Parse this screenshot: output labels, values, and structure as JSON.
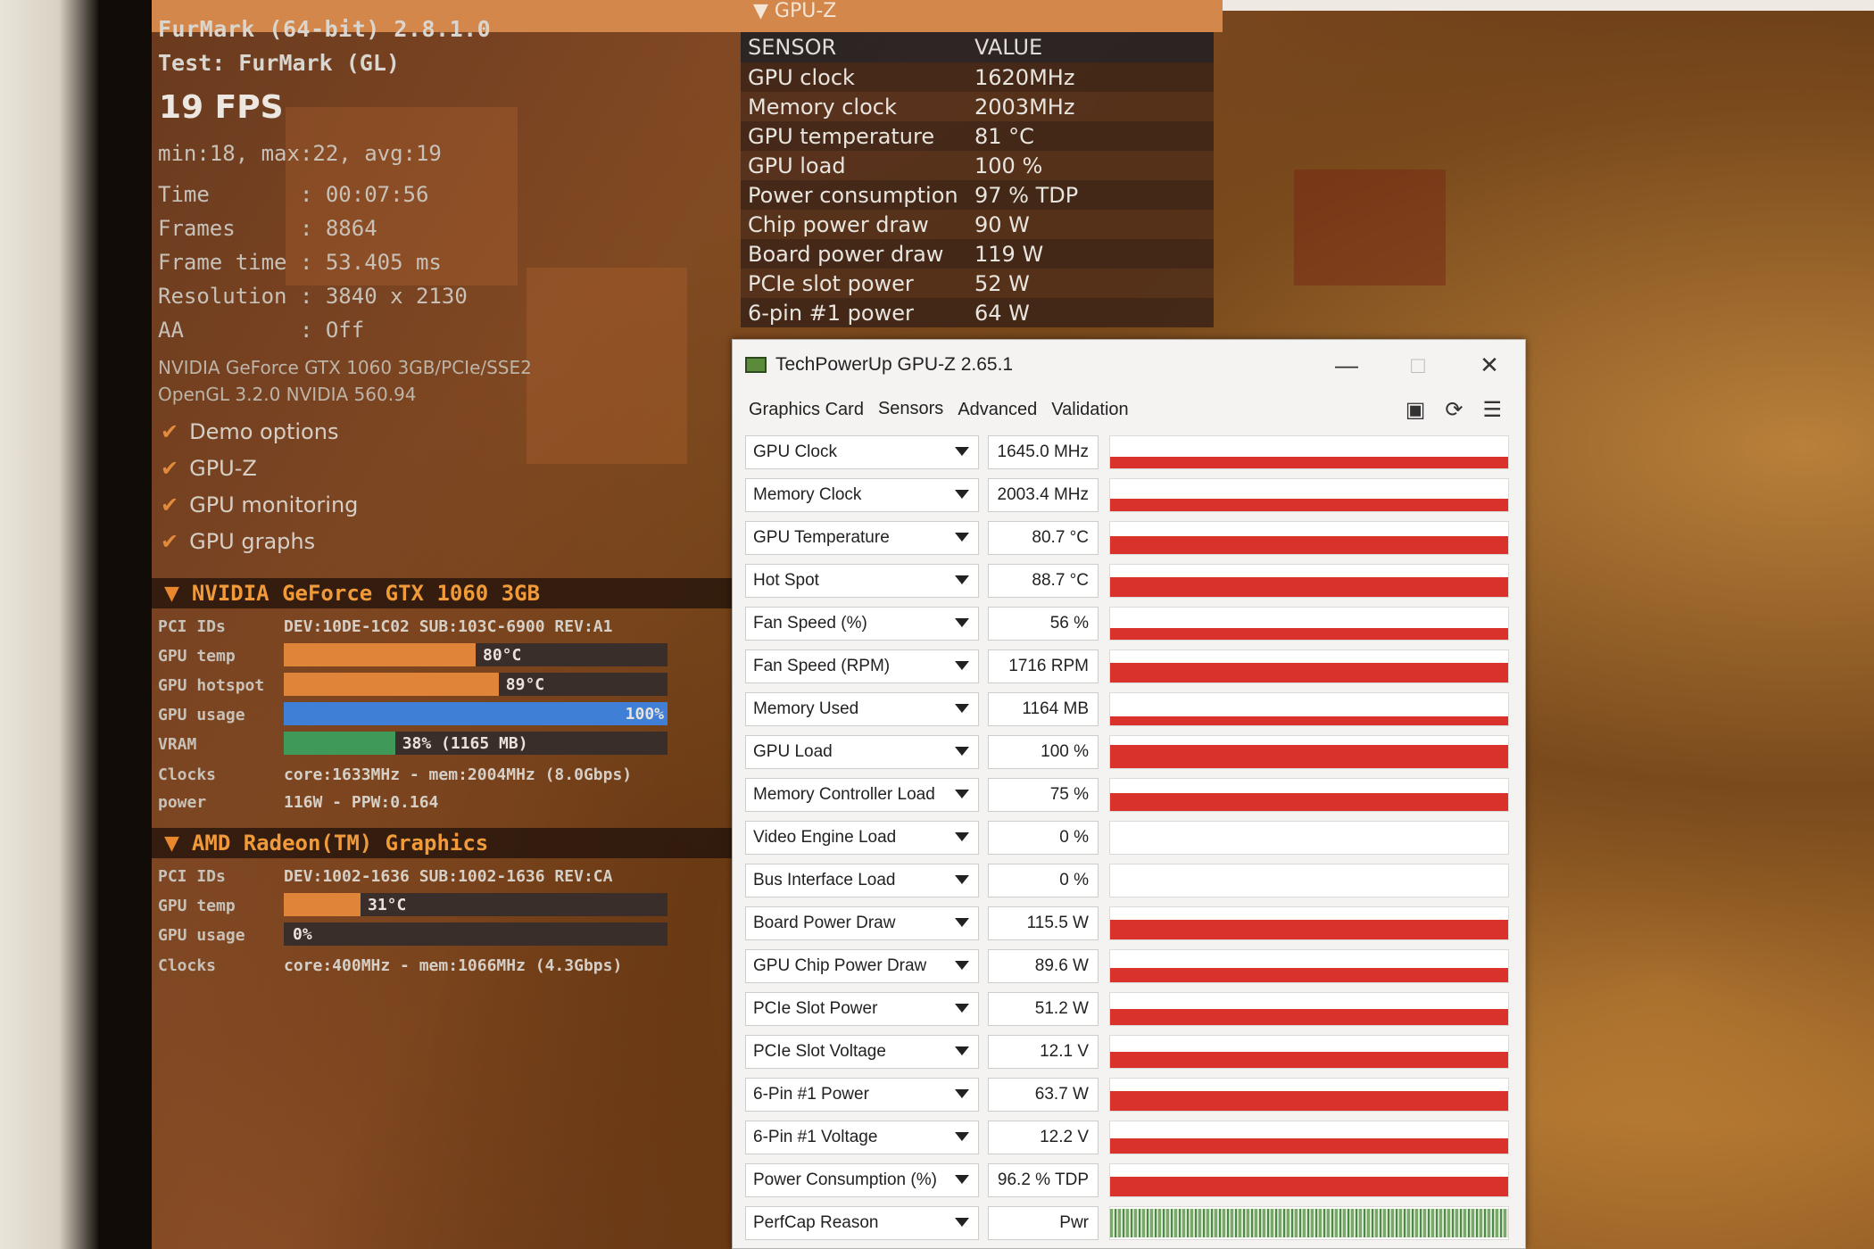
{
  "furmark": {
    "title": "FurMark (64-bit) 2.8.1.0",
    "test": "Test: FurMark (GL)",
    "fps": "19 FPS",
    "minmax": "min:18, max:22, avg:19",
    "stats": [
      {
        "label": "Time      ",
        "value": ": 00:07:56"
      },
      {
        "label": "Frames    ",
        "value": ": 8864"
      },
      {
        "label": "Frame time",
        "value": ": 53.405 ms"
      },
      {
        "label": "Resolution",
        "value": ": 3840 x 2130"
      },
      {
        "label": "AA        ",
        "value": ": Off"
      }
    ],
    "renderer": "NVIDIA GeForce GTX 1060 3GB/PCIe/SSE2",
    "opengl": "OpenGL 3.2.0 NVIDIA 560.94",
    "options": [
      "Demo options",
      "GPU-Z",
      "GPU monitoring",
      "GPU graphs"
    ],
    "gpu1": {
      "name": "NVIDIA GeForce GTX 1060 3GB",
      "pci_label": "PCI IDs",
      "pci": "DEV:10DE-1C02 SUB:103C-6900 REV:A1",
      "temp_label": "GPU temp",
      "temp": "80°C",
      "temp_pct": 0.5,
      "hotspot_label": "GPU hotspot",
      "hotspot": "89°C",
      "hotspot_pct": 0.56,
      "usage_label": "GPU usage",
      "usage": "100%",
      "usage_pct": 1.0,
      "vram_label": "VRAM",
      "vram": "38% (1165 MB)",
      "vram_pct": 0.29,
      "clocks_label": "Clocks",
      "clocks": "core:1633MHz - mem:2004MHz (8.0Gbps)",
      "power_label": "power",
      "power": "116W - PPW:0.164"
    },
    "gpu2": {
      "name": "AMD Radeon(TM) Graphics",
      "pci_label": "PCI IDs",
      "pci": "DEV:1002-1636 SUB:1002-1636 REV:CA",
      "temp_label": "GPU temp",
      "temp": "31°C",
      "temp_pct": 0.2,
      "usage_label": "GPU usage",
      "usage": "0%",
      "usage_pct": 0.0,
      "clocks_label": "Clocks",
      "clocks": "core:400MHz - mem:1066MHz (4.3Gbps)"
    },
    "colors": {
      "orange_bar": "#e0843a",
      "blue_bar": "#3f7fd6",
      "green_bar": "#3f9a5a"
    }
  },
  "gpuz_overlay": {
    "header": "▼ GPU-Z",
    "col_sensor": "SENSOR",
    "col_value": "VALUE",
    "rows": [
      {
        "sensor": "GPU clock",
        "value": "1620MHz"
      },
      {
        "sensor": "Memory clock",
        "value": "2003MHz"
      },
      {
        "sensor": "GPU temperature",
        "value": "81 °C"
      },
      {
        "sensor": "GPU load",
        "value": "100 %"
      },
      {
        "sensor": "Power consumption",
        "value": "97 % TDP"
      },
      {
        "sensor": "Chip power draw",
        "value": "90 W"
      },
      {
        "sensor": "Board power draw",
        "value": "119 W"
      },
      {
        "sensor": "PCIe slot power",
        "value": "52 W"
      },
      {
        "sensor": "6-pin #1 power",
        "value": "64 W"
      }
    ]
  },
  "gpuz_window": {
    "title": "TechPowerUp GPU-Z 2.65.1",
    "tabs": [
      "Graphics Card",
      "Sensors",
      "Advanced",
      "Validation"
    ],
    "active_tab": "Sensors",
    "icons": [
      "camera-icon",
      "refresh-icon",
      "menu-icon"
    ],
    "sensors": [
      {
        "name": "GPU Clock",
        "value": "1645.0 MHz",
        "level": 0.36
      },
      {
        "name": "Memory Clock",
        "value": "2003.4 MHz",
        "level": 0.4
      },
      {
        "name": "GPU Temperature",
        "value": "80.7 °C",
        "level": 0.55
      },
      {
        "name": "Hot Spot",
        "value": "88.7 °C",
        "level": 0.62
      },
      {
        "name": "Fan Speed (%)",
        "value": "56 %",
        "level": 0.36
      },
      {
        "name": "Fan Speed (RPM)",
        "value": "1716 RPM",
        "level": 0.6
      },
      {
        "name": "Memory Used",
        "value": "1164 MB",
        "level": 0.28
      },
      {
        "name": "GPU Load",
        "value": "100 %",
        "level": 0.72
      },
      {
        "name": "Memory Controller Load",
        "value": "75 %",
        "level": 0.55
      },
      {
        "name": "Video Engine Load",
        "value": "0 %",
        "level": 0.0
      },
      {
        "name": "Bus Interface Load",
        "value": "0 %",
        "level": 0.0
      },
      {
        "name": "Board Power Draw",
        "value": "115.5 W",
        "level": 0.6
      },
      {
        "name": "GPU Chip Power Draw",
        "value": "89.6 W",
        "level": 0.45
      },
      {
        "name": "PCIe Slot Power",
        "value": "51.2 W",
        "level": 0.5
      },
      {
        "name": "PCIe Slot Voltage",
        "value": "12.1 V",
        "level": 0.5
      },
      {
        "name": "6-Pin #1 Power",
        "value": "63.7 W",
        "level": 0.62
      },
      {
        "name": "6-Pin #1 Voltage",
        "value": "12.2 V",
        "level": 0.48
      },
      {
        "name": "Power Consumption (%)",
        "value": "96.2 % TDP",
        "level": 0.62
      },
      {
        "name": "PerfCap Reason",
        "value": "Pwr",
        "level": 1.0,
        "perfcap": true
      }
    ],
    "graph_color": "#d8322a"
  }
}
